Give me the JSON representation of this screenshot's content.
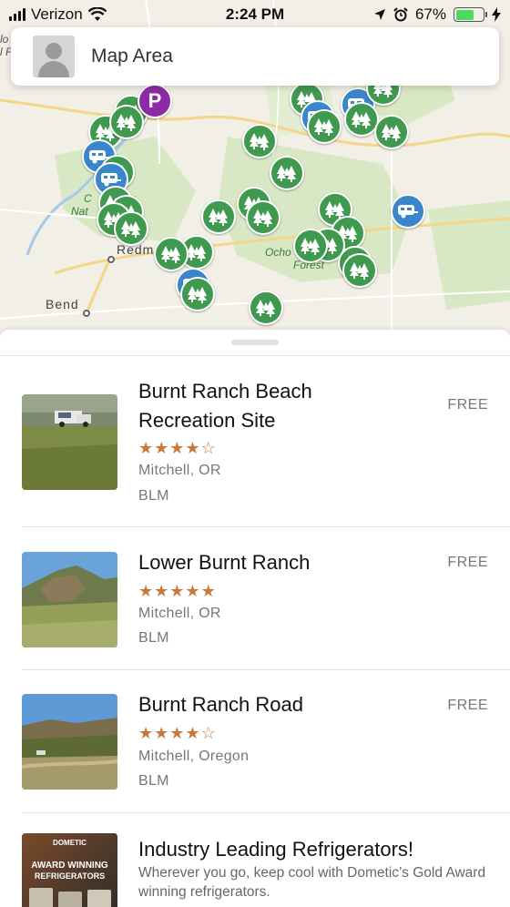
{
  "status_bar": {
    "carrier": "Verizon",
    "time": "2:24 PM",
    "battery_percent": "67%",
    "battery_level": 0.67,
    "icons": [
      "signal-icon",
      "wifi-icon",
      "location-arrow-icon",
      "alarm-icon",
      "battery-icon",
      "charging-bolt-icon"
    ]
  },
  "search": {
    "placeholder_label": "Map Area"
  },
  "map": {
    "labels": {
      "grassland_line1": "C      River",
      "grassland_line2": "Nat      ssland",
      "redmond": "Redm",
      "bend": "Bend",
      "ochoco_line1": "Ocho",
      "ochoco_line2": "Forest",
      "edge_left_1": "lo",
      "edge_left_2": "l F"
    },
    "parking_label": "P",
    "colors": {
      "tent_pin": "#3f9a4f",
      "rv_pin": "#3a86cc",
      "parking_pin": "#8e2aa6",
      "forest_area": "#d9e8c4",
      "road": "#f4d58a"
    }
  },
  "listings": [
    {
      "title_line1": "Burnt Ranch Beach",
      "title_line2": "Recreation Site",
      "price": "FREE",
      "rating": 4,
      "location": "Mitchell, OR",
      "agency": "BLM"
    },
    {
      "title_line1": "Lower Burnt Ranch",
      "price": "FREE",
      "rating": 5,
      "location": "Mitchell, OR",
      "agency": "BLM"
    },
    {
      "title_line1": "Burnt Ranch Road",
      "price": "FREE",
      "rating": 4,
      "location": "Mitchell, Oregon",
      "agency": "BLM"
    }
  ],
  "ad": {
    "title": "Industry Leading Refrigerators!",
    "description": "Wherever you go, keep cool with Dometic’s Gold Award winning refrigerators.",
    "image_text_brand": "DOMETIC",
    "image_text_line1": "AWARD WINNING",
    "image_text_line2": "REFRIGERATORS"
  },
  "star_glyphs": {
    "full": "★",
    "empty": "☆"
  },
  "accent": {
    "star": "#c8783a",
    "price": "#777777"
  }
}
